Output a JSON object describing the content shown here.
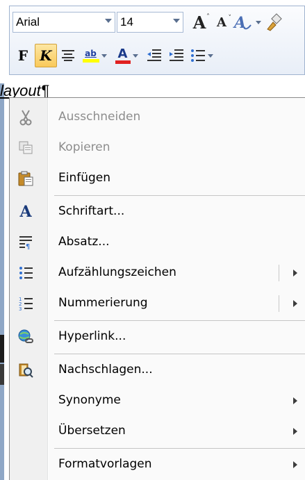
{
  "toolbar": {
    "font_name": "Arial",
    "font_size": "14",
    "grow_font_glyph": "A",
    "shrink_font_glyph": "A",
    "bold_glyph": "F",
    "italic_glyph": "K",
    "highlight_glyph": "ab",
    "font_color_glyph": "A",
    "highlight_color": "#ffff00",
    "font_color": "#e02020"
  },
  "document": {
    "visible_text": "layout¶"
  },
  "menu": {
    "items": [
      {
        "label": "Ausschneiden",
        "icon": "scissors-icon",
        "enabled": false
      },
      {
        "label": "Kopieren",
        "icon": "copy-icon",
        "enabled": false
      },
      {
        "label": "Einfügen",
        "icon": "paste-icon",
        "enabled": true
      },
      {
        "label": "Schriftart...",
        "icon": "font-icon",
        "enabled": true
      },
      {
        "label": "Absatz...",
        "icon": "paragraph-icon",
        "enabled": true
      },
      {
        "label": "Aufzählungszeichen",
        "icon": "bullets-icon",
        "enabled": true,
        "submenu": true
      },
      {
        "label": "Nummerierung",
        "icon": "numbering-icon",
        "enabled": true,
        "submenu": true
      },
      {
        "label": "Hyperlink...",
        "icon": "hyperlink-icon",
        "enabled": true
      },
      {
        "label": "Nachschlagen...",
        "icon": "research-icon",
        "enabled": true
      },
      {
        "label": "Synonyme",
        "icon": "",
        "enabled": true,
        "submenu": true
      },
      {
        "label": "Übersetzen",
        "icon": "",
        "enabled": true,
        "submenu": true
      },
      {
        "label": "Formatvorlagen",
        "icon": "",
        "enabled": true,
        "submenu": true
      }
    ]
  }
}
